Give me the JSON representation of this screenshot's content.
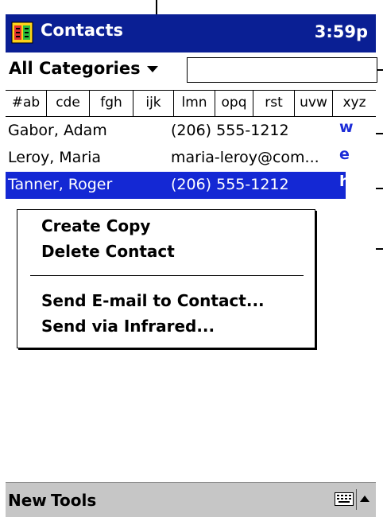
{
  "titlebar": {
    "app_title": "Contacts",
    "clock": "3:59p",
    "app_icon": "contacts-app-icon"
  },
  "category_bar": {
    "category_label": "All Categories",
    "find_value": "",
    "dropdown_icon": "triangle-down-icon"
  },
  "letter_tabs": [
    "#ab",
    "cde",
    "fgh",
    "ijk",
    "lmn",
    "opq",
    "rst",
    "uvw",
    "xyz"
  ],
  "contacts": [
    {
      "name": "Gabor, Adam",
      "detail": "(206) 555-1212",
      "indicator": "w",
      "selected": false
    },
    {
      "name": "Leroy, Maria",
      "detail": "maria-leroy@com...",
      "indicator": "e",
      "selected": false
    },
    {
      "name": "Tanner, Roger",
      "detail": "(206) 555-1212",
      "indicator": "h",
      "selected": true
    }
  ],
  "context_menu": {
    "items": [
      "Create Copy",
      "Delete Contact",
      "Send E-mail to Contact...",
      "Send via Infrared..."
    ]
  },
  "menu_bar": {
    "new_label": "New",
    "tools_label": "Tools",
    "keyboard_icon": "keyboard-icon",
    "sip_icon": "sip-up-arrow-icon"
  },
  "colors": {
    "titlebar": "#0a1f94",
    "selection": "#1428d4",
    "indicator": "#1d2dd8",
    "menubar": "#c6c6c6"
  }
}
